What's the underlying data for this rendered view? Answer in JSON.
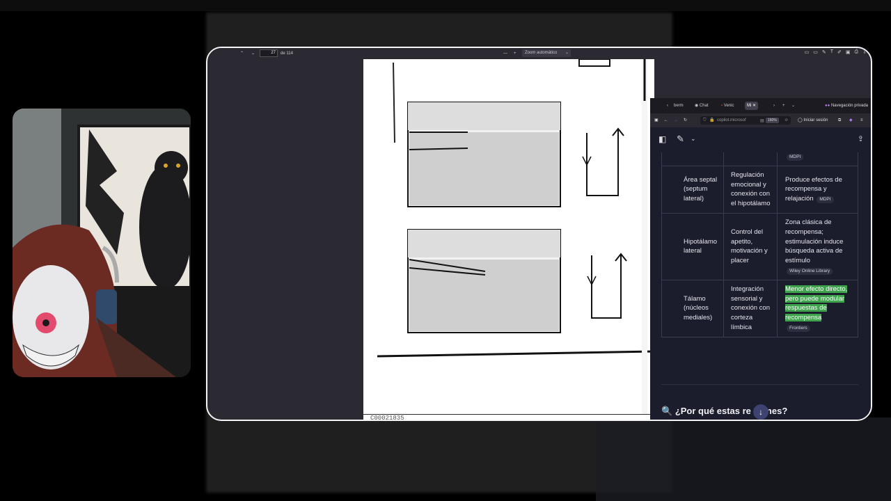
{
  "pdf_viewer": {
    "page_number": "27",
    "page_total": "de 114",
    "zoom": "Zoom automático",
    "footer_code": "C00021835"
  },
  "browser": {
    "tabs": [
      "berm",
      "Chat",
      "Venic",
      "Mi"
    ],
    "private_label": "Navegación privada",
    "url": "copilot.microsof",
    "zoom": "160%",
    "sign_in": "Iniciar sesión"
  },
  "table": {
    "rows": [
      {
        "region": "",
        "function": "",
        "effect": "",
        "citation": "MDPI",
        "highlight": false
      },
      {
        "region": "Área septal (septum lateral)",
        "function": "Regulación emocional y conexión con el hipotálamo",
        "effect": "Produce efectos de recompensa y relajación",
        "citation": "MDPI",
        "highlight": false
      },
      {
        "region": "Hipotálamo lateral",
        "function": "Control del apetito, motivación y placer",
        "effect": "Zona clásica de recompensa; estimulación induce búsqueda activa de estímulo",
        "citation": "Wiley Online Library",
        "highlight": false
      },
      {
        "region": "Tálamo (núcleos mediales)",
        "function": "Integración sensorial y conexión con corteza límbica",
        "effect": "Menor efecto directo, pero puede modular respuestas de recompensa",
        "citation": "Frontiers",
        "highlight": true
      }
    ]
  },
  "question": {
    "icon": "🔍",
    "prefix": "¿Por qué estas re",
    "suffix": "nes?"
  },
  "colors": {
    "highlight": "#3fa34d",
    "panel_bg": "#1b1c2c",
    "window_border": "#f5f5f5"
  }
}
